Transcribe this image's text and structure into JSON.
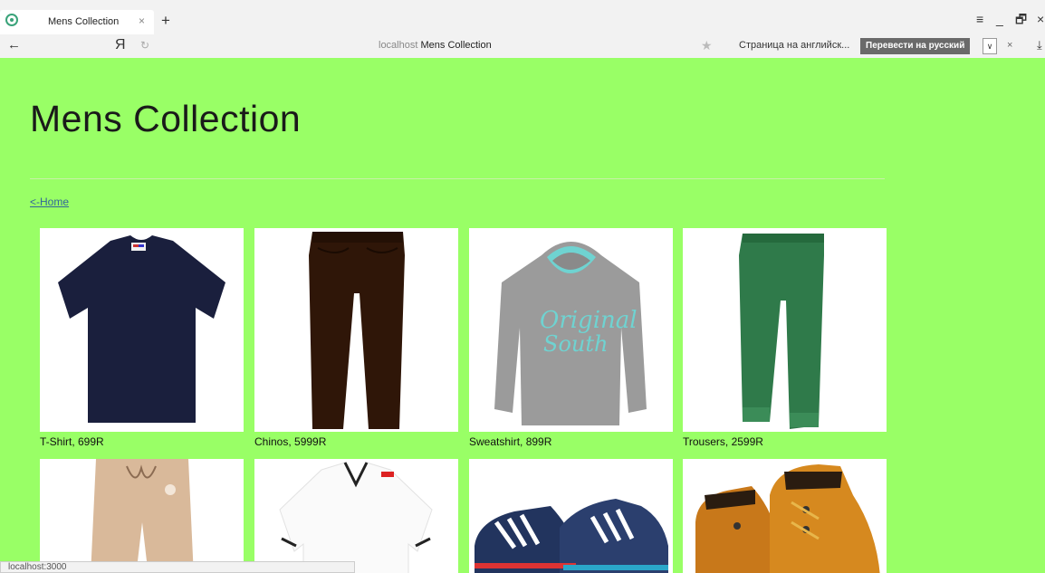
{
  "browser": {
    "tab_title": "Mens Collection",
    "tab_close": "×",
    "new_tab": "+",
    "back": "←",
    "logo": "Я",
    "reload": "↻",
    "url_host": "localhost",
    "url_title": "Mens Collection",
    "star": "★",
    "translate_prompt": "Страница на английск...",
    "translate_button": "Перевести на русский",
    "translate_dropdown": "∨",
    "translate_close": "×",
    "menu": "≡",
    "minimize": "_",
    "restore": "🗗",
    "close": "×",
    "download": "⤓",
    "status_url": "localhost:3000"
  },
  "page": {
    "title": "Mens Collection",
    "home_link": "<-Home"
  },
  "products": [
    {
      "caption": "T-Shirt, 699R",
      "icon": "tshirt-image"
    },
    {
      "caption": "Chinos, 5999R",
      "icon": "chinos-image"
    },
    {
      "caption": "Sweatshirt, 899R",
      "icon": "sweatshirt-image"
    },
    {
      "caption": "Trousers, 2599R",
      "icon": "trousers-image"
    },
    {
      "caption": "",
      "icon": "shorts-image"
    },
    {
      "caption": "",
      "icon": "polo-image"
    },
    {
      "caption": "",
      "icon": "sneakers-image"
    },
    {
      "caption": "",
      "icon": "boots-image"
    }
  ],
  "colors": {
    "page_background": "#99ff66",
    "link": "#336699"
  }
}
